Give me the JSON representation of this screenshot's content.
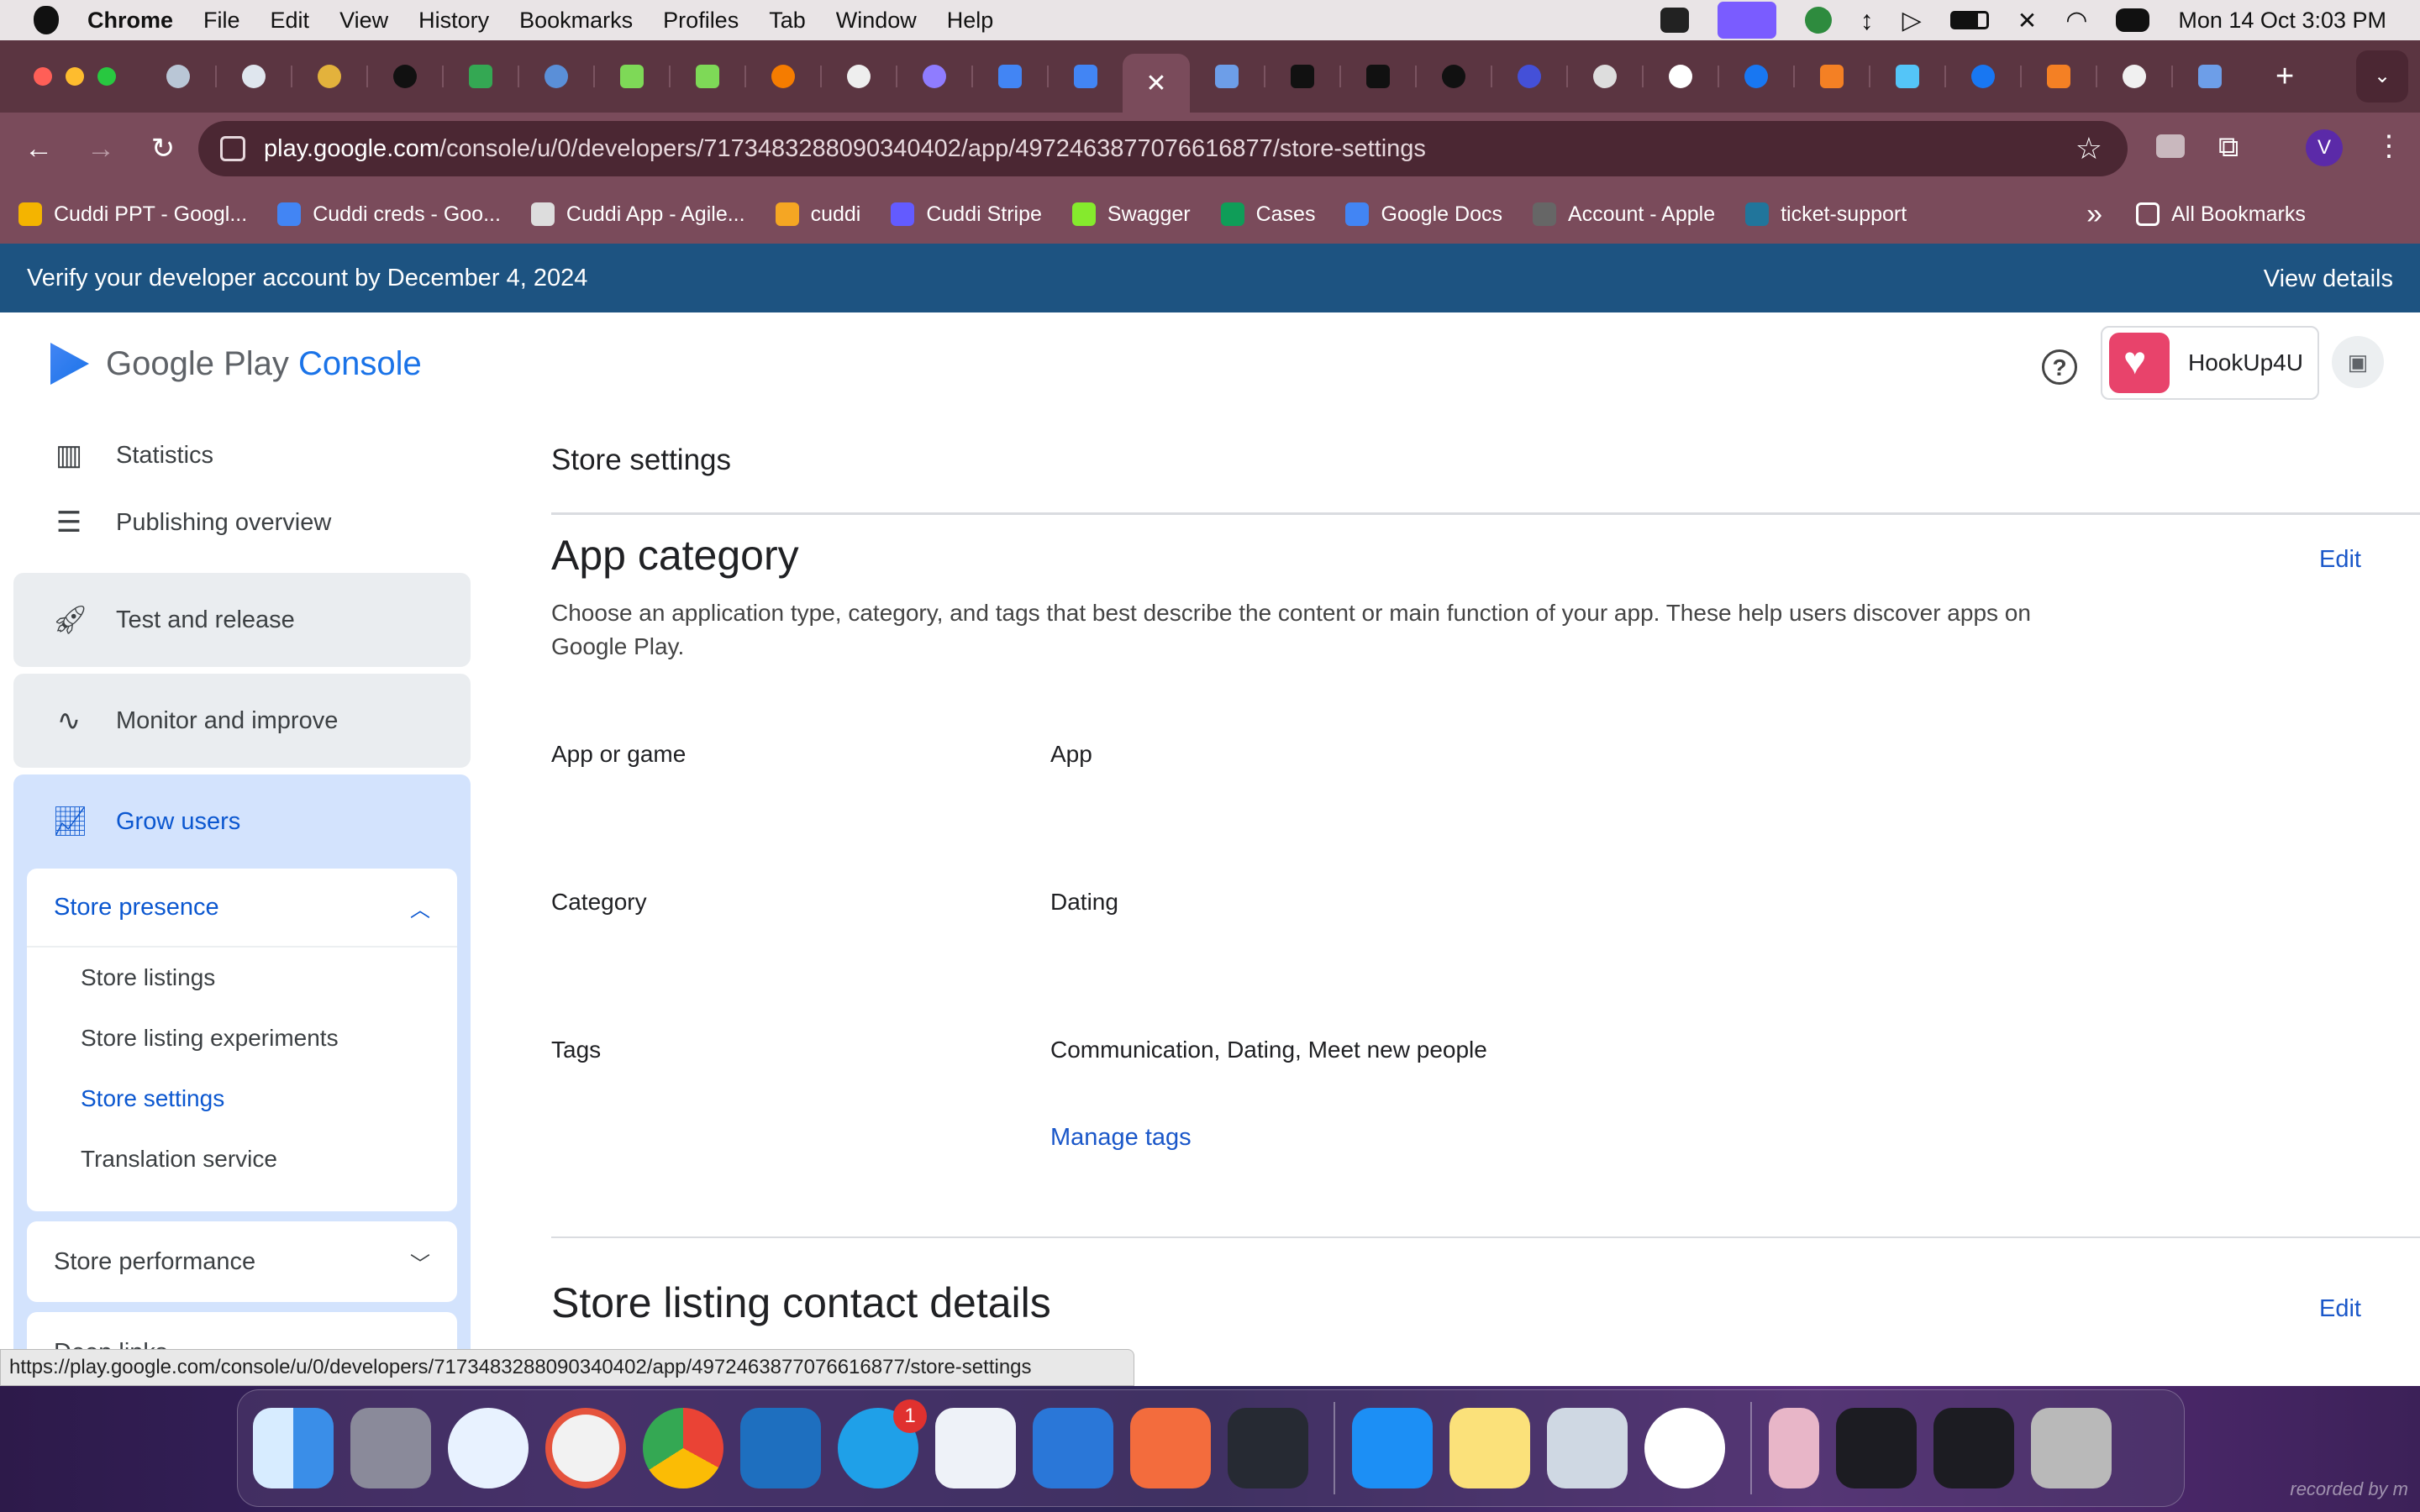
{
  "menubar": {
    "app_name": "Chrome",
    "items": [
      "File",
      "Edit",
      "View",
      "History",
      "Bookmarks",
      "Profiles",
      "Tab",
      "Window",
      "Help"
    ],
    "datetime": "Mon 14 Oct  3:03 PM"
  },
  "browser": {
    "url_host": "play.google.com",
    "url_path": "/console/u/0/developers/7173483288090340402/app/4972463877076616877/store-settings",
    "profile_initial": "V",
    "bookmarks": [
      "Cuddi PPT - Googl...",
      "Cuddi creds - Goo...",
      "Cuddi App - Agile...",
      "cuddi",
      "Cuddi Stripe",
      "Swagger",
      "Cases",
      "Google Docs",
      "Account - Apple",
      "ticket-support"
    ],
    "all_bookmarks_label": "All Bookmarks",
    "bookmark_colors": [
      "#f4b400",
      "#4285f4",
      "#dddddd",
      "#f5a623",
      "#635bff",
      "#85ea2d",
      "#0f9d58",
      "#4285f4",
      "#666666",
      "#21759b"
    ]
  },
  "banner": {
    "message": "Verify your developer account by December 4, 2024",
    "action": "View details"
  },
  "header": {
    "logo_google_play": "Google Play",
    "logo_console": "Console",
    "help_glyph": "?",
    "app_name": "HookUp4U"
  },
  "sidebar": {
    "statistics": "Statistics",
    "publishing_overview": "Publishing overview",
    "test_and_release": "Test and release",
    "monitor_and_improve": "Monitor and improve",
    "grow_users": "Grow users",
    "store_presence": {
      "label": "Store presence",
      "items": [
        "Store listings",
        "Store listing experiments",
        "Store settings",
        "Translation service"
      ],
      "selected": "Store settings"
    },
    "store_performance": "Store performance",
    "deep_links": "Deep links"
  },
  "main": {
    "page_title": "Store settings",
    "app_category": {
      "title": "App category",
      "edit": "Edit",
      "description": "Choose an application type, category, and tags that best describe the content or main function of your app. These help users discover apps on Google Play.",
      "rows": [
        {
          "label": "App or game",
          "value": "App"
        },
        {
          "label": "Category",
          "value": "Dating"
        },
        {
          "label": "Tags",
          "value": "Communication, Dating, Meet new people"
        }
      ],
      "manage_tags": "Manage tags"
    },
    "contact_details": {
      "title": "Store listing contact details",
      "edit": "Edit"
    }
  },
  "status_url": "https://play.google.com/console/u/0/developers/7173483288090340402/app/4972463877076616877/store-settings",
  "dock": {
    "skype_badge": "1",
    "watermark": "recorded by m"
  }
}
